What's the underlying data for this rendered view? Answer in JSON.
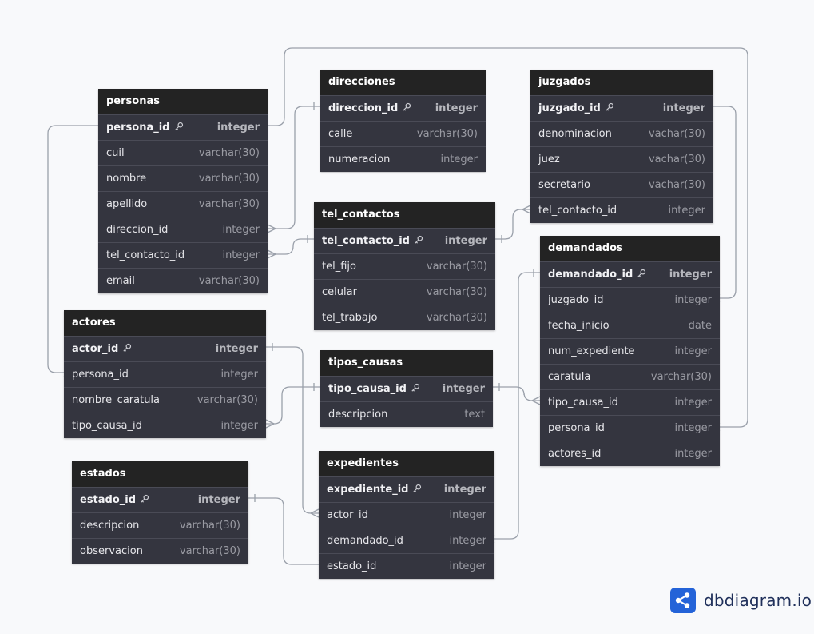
{
  "tables": [
    {
      "id": "personas",
      "name": "personas",
      "fields": [
        {
          "name": "persona_id",
          "type": "integer",
          "pk": true
        },
        {
          "name": "cuil",
          "type": "varchar(30)"
        },
        {
          "name": "nombre",
          "type": "varchar(30)"
        },
        {
          "name": "apellido",
          "type": "varchar(30)"
        },
        {
          "name": "direccion_id",
          "type": "integer"
        },
        {
          "name": "tel_contacto_id",
          "type": "integer"
        },
        {
          "name": "email",
          "type": "varchar(30)"
        }
      ]
    },
    {
      "id": "direcciones",
      "name": "direcciones",
      "fields": [
        {
          "name": "direccion_id",
          "type": "integer",
          "pk": true
        },
        {
          "name": "calle",
          "type": "varchar(30)"
        },
        {
          "name": "numeracion",
          "type": "integer"
        }
      ]
    },
    {
      "id": "juzgados",
      "name": "juzgados",
      "fields": [
        {
          "name": "juzgado_id",
          "type": "integer",
          "pk": true
        },
        {
          "name": "denominacion",
          "type": "vachar(30)"
        },
        {
          "name": "juez",
          "type": "vachar(30)"
        },
        {
          "name": "secretario",
          "type": "vachar(30)"
        },
        {
          "name": "tel_contacto_id",
          "type": "integer"
        }
      ]
    },
    {
      "id": "tel_contactos",
      "name": "tel_contactos",
      "fields": [
        {
          "name": "tel_contacto_id",
          "type": "integer",
          "pk": true
        },
        {
          "name": "tel_fijo",
          "type": "varchar(30)"
        },
        {
          "name": "celular",
          "type": "varchar(30)"
        },
        {
          "name": "tel_trabajo",
          "type": "varchar(30)"
        }
      ]
    },
    {
      "id": "demandados",
      "name": "demandados",
      "fields": [
        {
          "name": "demandado_id",
          "type": "integer",
          "pk": true
        },
        {
          "name": "juzgado_id",
          "type": "integer"
        },
        {
          "name": "fecha_inicio",
          "type": "date"
        },
        {
          "name": "num_expediente",
          "type": "integer"
        },
        {
          "name": "caratula",
          "type": "varchar(30)"
        },
        {
          "name": "tipo_causa_id",
          "type": "integer"
        },
        {
          "name": "persona_id",
          "type": "integer"
        },
        {
          "name": "actores_id",
          "type": "integer"
        }
      ]
    },
    {
      "id": "actores",
      "name": "actores",
      "fields": [
        {
          "name": "actor_id",
          "type": "integer",
          "pk": true
        },
        {
          "name": "persona_id",
          "type": "integer"
        },
        {
          "name": "nombre_caratula",
          "type": "varchar(30)"
        },
        {
          "name": "tipo_causa_id",
          "type": "integer"
        }
      ]
    },
    {
      "id": "tipos_causas",
      "name": "tipos_causas",
      "fields": [
        {
          "name": "tipo_causa_id",
          "type": "integer",
          "pk": true
        },
        {
          "name": "descripcion",
          "type": "text"
        }
      ]
    },
    {
      "id": "estados",
      "name": "estados",
      "fields": [
        {
          "name": "estado_id",
          "type": "integer",
          "pk": true
        },
        {
          "name": "descripcion",
          "type": "varchar(30)"
        },
        {
          "name": "observacion",
          "type": "varchar(30)"
        }
      ]
    },
    {
      "id": "expedientes",
      "name": "expedientes",
      "fields": [
        {
          "name": "expediente_id",
          "type": "integer",
          "pk": true
        },
        {
          "name": "actor_id",
          "type": "integer"
        },
        {
          "name": "demandado_id",
          "type": "integer"
        },
        {
          "name": "estado_id",
          "type": "integer"
        }
      ]
    }
  ],
  "relations": [
    {
      "from": "personas.direccion_id",
      "to": "direcciones.direccion_id"
    },
    {
      "from": "personas.tel_contacto_id",
      "to": "tel_contactos.tel_contacto_id"
    },
    {
      "from": "juzgados.tel_contacto_id",
      "to": "tel_contactos.tel_contacto_id"
    },
    {
      "from": "demandados.juzgado_id",
      "to": "juzgados.juzgado_id"
    },
    {
      "from": "demandados.persona_id",
      "to": "personas.persona_id"
    },
    {
      "from": "actores.persona_id",
      "to": "personas.persona_id"
    },
    {
      "from": "actores.tipo_causa_id",
      "to": "tipos_causas.tipo_causa_id"
    },
    {
      "from": "demandados.tipo_causa_id",
      "to": "tipos_causas.tipo_causa_id"
    },
    {
      "from": "expedientes.actor_id",
      "to": "actores.actor_id"
    },
    {
      "from": "expedientes.demandado_id",
      "to": "demandados.demandado_id"
    },
    {
      "from": "expedientes.estado_id",
      "to": "estados.estado_id"
    }
  ],
  "colors": {
    "header": "#232323",
    "body": "#34353f",
    "line": "#9aa0aa",
    "brand": "#2463d8"
  },
  "logo": {
    "icon": "share-nodes-icon",
    "text": "dbdiagram.io"
  }
}
